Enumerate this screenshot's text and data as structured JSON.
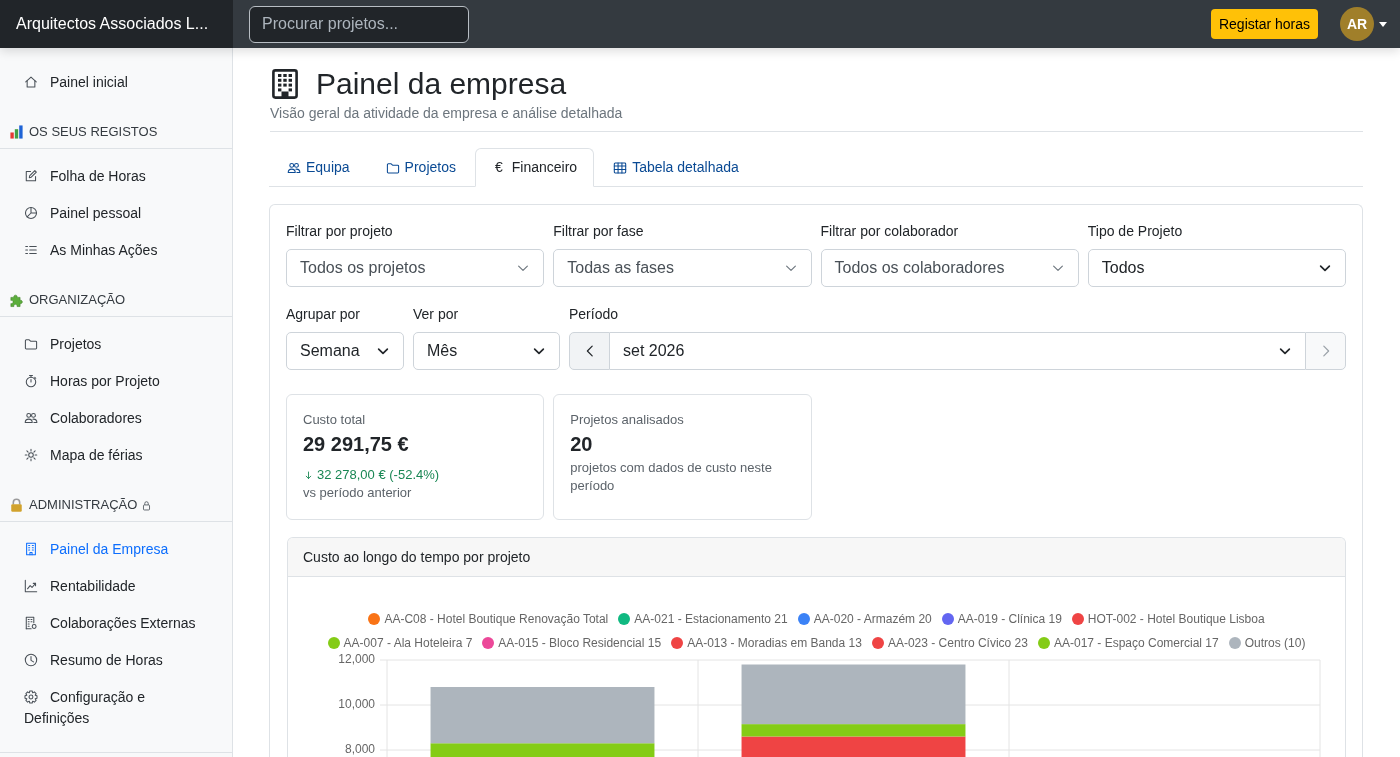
{
  "topbar": {
    "brand": "Arquitectos Associados L...",
    "search": {
      "placeholder": "Procurar projetos..."
    },
    "action_button": "Registar horas",
    "avatar": "AR"
  },
  "sidebar": {
    "home": {
      "label": "Painel inicial",
      "selected": false
    },
    "sections": [
      {
        "title": "OS SEUS REGISTOS",
        "locked": false,
        "items": [
          {
            "label": "Folha de Horas",
            "selected": false
          },
          {
            "label": "Painel pessoal",
            "selected": false
          },
          {
            "label": "As Minhas Ações",
            "selected": false
          }
        ]
      },
      {
        "title": "ORGANIZAÇÃO",
        "locked": false,
        "items": [
          {
            "label": "Projetos",
            "selected": false
          },
          {
            "label": "Horas por Projeto",
            "selected": false
          },
          {
            "label": "Colaboradores",
            "selected": false
          },
          {
            "label": "Mapa de férias",
            "selected": false
          }
        ]
      },
      {
        "title": "ADMINISTRAÇÃO",
        "locked": true,
        "items": [
          {
            "label": "Painel da Empresa",
            "selected": true
          },
          {
            "label": "Rentabilidade",
            "selected": false
          },
          {
            "label": "Colaborações Externas",
            "selected": false
          },
          {
            "label": "Resumo de Horas",
            "selected": false
          },
          {
            "label": "Configuração e Definições",
            "selected": false
          }
        ]
      }
    ]
  },
  "page": {
    "title": "Painel da empresa",
    "subtitle": "Visão geral da atividade da empresa e análise detalhada"
  },
  "tabs": [
    {
      "label": "Equipa",
      "selected": false
    },
    {
      "label": "Projetos",
      "selected": false
    },
    {
      "label": "Financeiro",
      "symbol": "€",
      "selected": true
    },
    {
      "label": "Tabela detalhada",
      "selected": false
    }
  ],
  "filters": {
    "row_1": [
      {
        "label": "Filtrar por projeto",
        "value": "Todos os projetos",
        "kind": "combo"
      },
      {
        "label": "Filtrar por fase",
        "value": "Todas as fases",
        "kind": "combo"
      },
      {
        "label": "Filtrar por colaborador",
        "value": "Todos os colaboradores",
        "kind": "combo"
      },
      {
        "label": "Tipo de Projeto",
        "value": "Todos",
        "kind": "native"
      }
    ],
    "row_2": [
      {
        "label": "Agrupar por",
        "value": "Semana",
        "kind": "native"
      },
      {
        "label": "Ver por",
        "value": "Mês",
        "kind": "native"
      }
    ],
    "period": {
      "label": "Período",
      "value": "set 2026",
      "prev": {
        "disabled": false
      },
      "next": {
        "disabled": true
      }
    }
  },
  "stats": [
    {
      "label": "Custo total",
      "value": "29 291,75 €",
      "change": {
        "text": "32 278,00 € (-52.4%)",
        "down": true
      },
      "note": "vs período anterior"
    },
    {
      "label": "Projetos analisados",
      "value": "20",
      "note": "projetos com dados de custo neste período"
    }
  ],
  "chart_card": {
    "title": "Custo ao longo do tempo por projeto",
    "chart_data": {
      "type": "bar",
      "stacked": true,
      "legend": "top",
      "ylim": [
        0,
        12000
      ],
      "yticks": [
        {
          "value": 8000,
          "label": "8,000"
        },
        {
          "value": 10000,
          "label": "10,000"
        },
        {
          "value": 12000,
          "label": "12,000"
        }
      ],
      "series": [
        {
          "name": "AA-C08 - Hotel Boutique Renovação Total",
          "color": "#f97316",
          "values": [
            null,
            null,
            null
          ]
        },
        {
          "name": "AA-021 - Estacionamento 21",
          "color": "#10b981",
          "values": [
            null,
            null,
            null
          ]
        },
        {
          "name": "AA-020 - Armazém 20",
          "color": "#3b82f6",
          "values": [
            null,
            null,
            null
          ]
        },
        {
          "name": "AA-019 - Clínica 19",
          "color": "#6366f1",
          "values": [
            null,
            null,
            null
          ]
        },
        {
          "name": "HOT-002 - Hotel Boutique Lisboa",
          "color": "#ef4444",
          "values": [
            null,
            null,
            null
          ]
        },
        {
          "name": "AA-007 - Ala Hoteleira 7",
          "color": "#84cc16",
          "values": [
            null,
            null,
            null
          ]
        },
        {
          "name": "AA-015 - Bloco Residencial 15",
          "color": "#ec4899",
          "values": [
            null,
            null,
            null
          ]
        },
        {
          "name": "AA-013 - Moradias em Banda 13",
          "color": "#ef4444",
          "values": [
            null,
            null,
            null
          ]
        },
        {
          "name": "AA-023 - Centro Cívico 23",
          "color": "#ef4444",
          "values": [
            null,
            8600,
            null
          ]
        },
        {
          "name": "AA-017 - Espaço Comercial 17",
          "color": "#84cc16",
          "values": [
            8300,
            550,
            null
          ]
        },
        {
          "name": "Outros (10)",
          "color": "#adb5bd",
          "values": [
            2500,
            2650,
            null
          ]
        }
      ]
    }
  }
}
